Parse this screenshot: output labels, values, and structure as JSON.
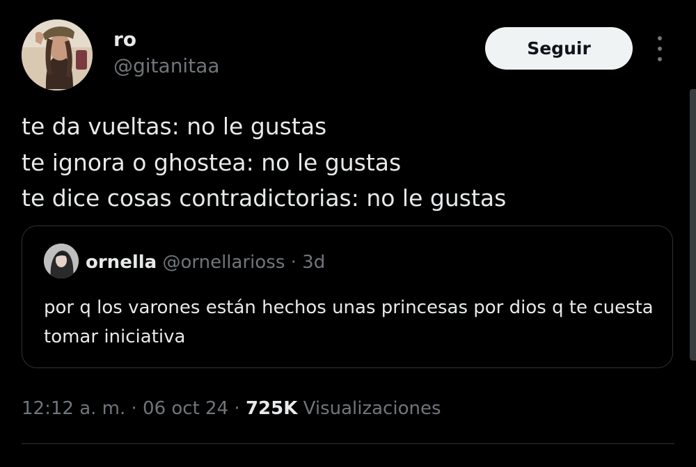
{
  "author": {
    "display_name": "ro",
    "handle": "@gitanitaa",
    "avatar_icon": "profile-photo"
  },
  "follow_button_label": "Seguir",
  "more_icon": "more-options-vertical-icon",
  "tweet": {
    "lines": [
      "te da vueltas: no le gustas",
      "te ignora o ghostea: no le gustas",
      "te dice cosas contradictorias: no le gustas"
    ]
  },
  "quoted_tweet": {
    "display_name": "ornella",
    "handle": "@ornellarioss",
    "separator": "·",
    "time": "3d",
    "text": "por q los varones están hechos unas princesas por dios q te cuesta tomar iniciativa"
  },
  "meta": {
    "time": "12:12 a. m.",
    "separator_1": "·",
    "date": "06 oct 24",
    "separator_2": "·",
    "views_count": "725K",
    "views_label": "Visualizaciones"
  },
  "colors": {
    "background": "#000000",
    "primary_text": "#e7e9ea",
    "secondary_text": "#71767b",
    "border": "#2f3336",
    "button_bg": "#eff3f4"
  }
}
